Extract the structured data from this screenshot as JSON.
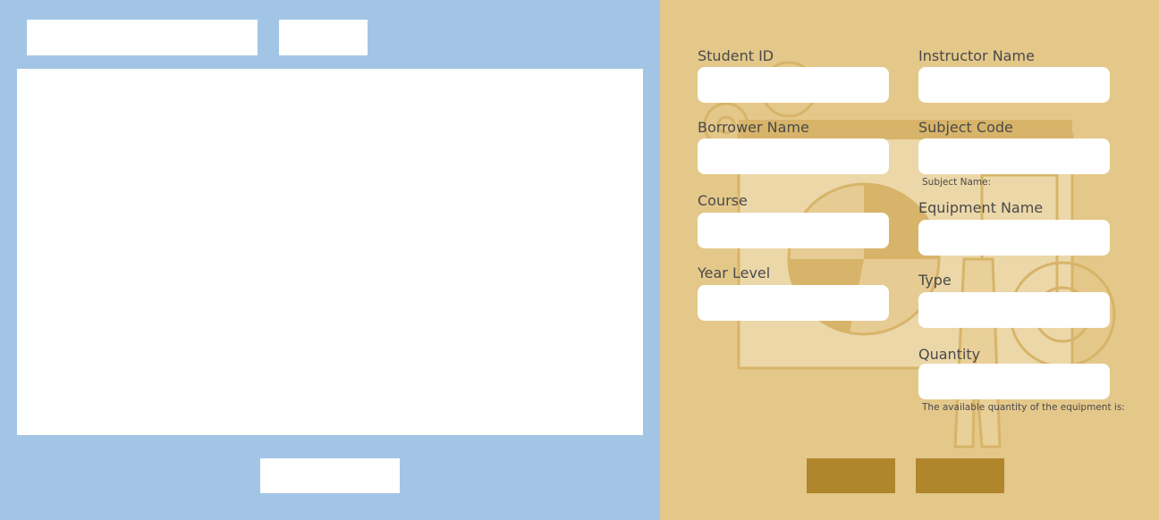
{
  "search": {
    "query": "",
    "button_label": ""
  },
  "list": {
    "rows": []
  },
  "left_action": {
    "label": ""
  },
  "form": {
    "student_id": {
      "label": "Student ID",
      "value": ""
    },
    "borrower_name": {
      "label": "Borrower Name",
      "value": ""
    },
    "course": {
      "label": "Course",
      "value": ""
    },
    "year_level": {
      "label": "Year Level",
      "value": ""
    },
    "instructor_name": {
      "label": "Instructor Name",
      "value": ""
    },
    "subject_code": {
      "label": "Subject Code",
      "value": ""
    },
    "subject_name_note": "Subject Name:",
    "equipment_name": {
      "label": "Equipment Name",
      "value": ""
    },
    "type": {
      "label": "Type",
      "value": ""
    },
    "quantity": {
      "label": "Quantity",
      "value": ""
    },
    "available_note": "The available quantity of the equipment is:"
  },
  "actions": {
    "first_label": "",
    "second_label": ""
  },
  "colors": {
    "left_panel": "#a2c5e6",
    "right_panel": "#e4c88a",
    "button": "#b0862c",
    "illustration": "#d7b469"
  }
}
